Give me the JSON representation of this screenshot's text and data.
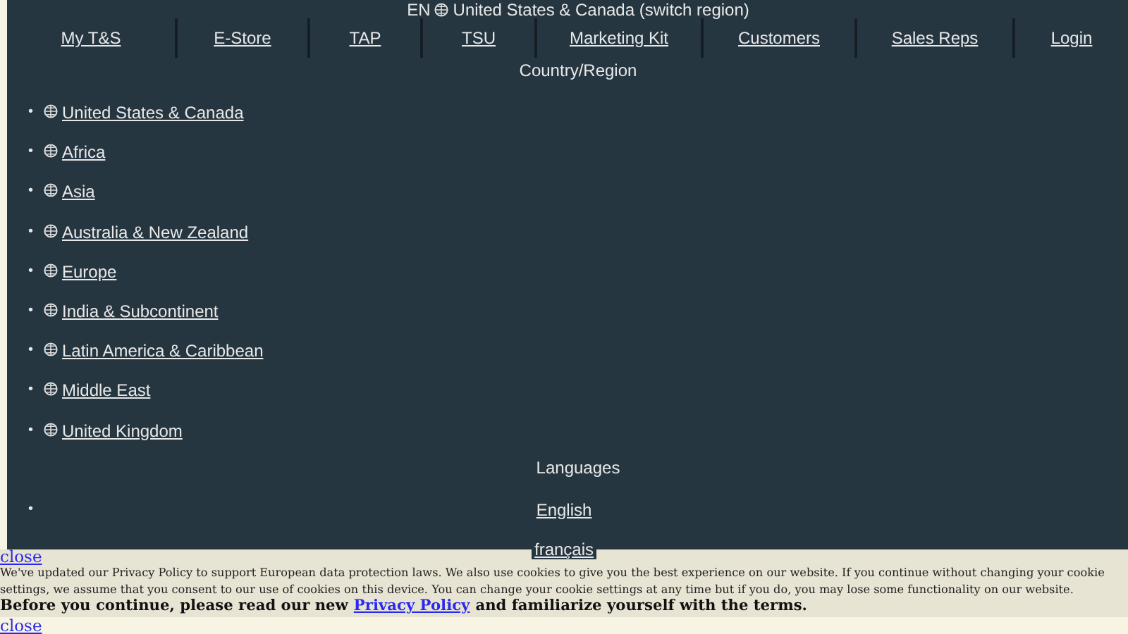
{
  "header": {
    "language": "EN",
    "region": "United States & Canada (switch region)"
  },
  "nav": [
    "My T&S",
    "E-Store",
    "TAP",
    "TSU",
    "Marketing Kit",
    "Customers",
    "Sales Reps",
    "Login"
  ],
  "country_heading": "Country/Region",
  "regions": [
    {
      "marker": "•",
      "name": "United States & Canada"
    },
    {
      "marker": "•",
      "name": "Africa"
    },
    {
      "marker": "•",
      "name": "Asia"
    },
    {
      "marker": "•",
      "name": "Australia & New Zealand"
    },
    {
      "marker": "•",
      "name": "Europe"
    },
    {
      "marker": "•",
      "name": "India & Subcontinent"
    },
    {
      "marker": "•",
      "name": "Latin America & Caribbean"
    },
    {
      "marker": "•",
      "name": "Middle East"
    },
    {
      "marker": "•",
      "name": "United Kingdom"
    }
  ],
  "languages_heading": "Languages",
  "languages": [
    {
      "marker": "•",
      "name": "English"
    },
    {
      "name": "français"
    }
  ],
  "cookie_banner": {
    "close_top": "close",
    "message": "We've updated our Privacy Policy to support European data protection laws. We also use cookies to give you the best experience on our website. If you continue without changing your cookie settings, we assume that you consent to our use of cookies on this device. You can change your cookie settings at any time but if you do, you may lose some functionality on our website.",
    "notice_before": "Before you continue, please read our new",
    "notice_link": "Privacy Policy",
    "notice_after": "and familiarize yourself with the terms.",
    "close_bottom": "close"
  }
}
